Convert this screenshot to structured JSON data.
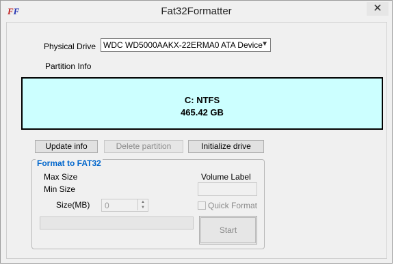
{
  "window": {
    "title": "Fat32Formatter",
    "close_glyph": "✕",
    "icon_letters": [
      "F",
      "F"
    ]
  },
  "drive": {
    "label": "Physical Drive",
    "selected": "WDC WD5000AAKX-22ERMA0 ATA Device"
  },
  "partition": {
    "label": "Partition Info",
    "line1": "C: NTFS",
    "line2": "465.42 GB",
    "box_color": "#ccffff"
  },
  "buttons": {
    "update": "Update info",
    "delete": "Delete partition",
    "initialize": "Initialize drive"
  },
  "format": {
    "group_title": "Format to FAT32",
    "max_size": "Max Size",
    "min_size": "Min Size",
    "size_label": "Size(MB)",
    "size_value": "0",
    "volume_label": "Volume Label",
    "quick_format": "Quick Format",
    "start": "Start",
    "accent_color": "#0066cc"
  }
}
